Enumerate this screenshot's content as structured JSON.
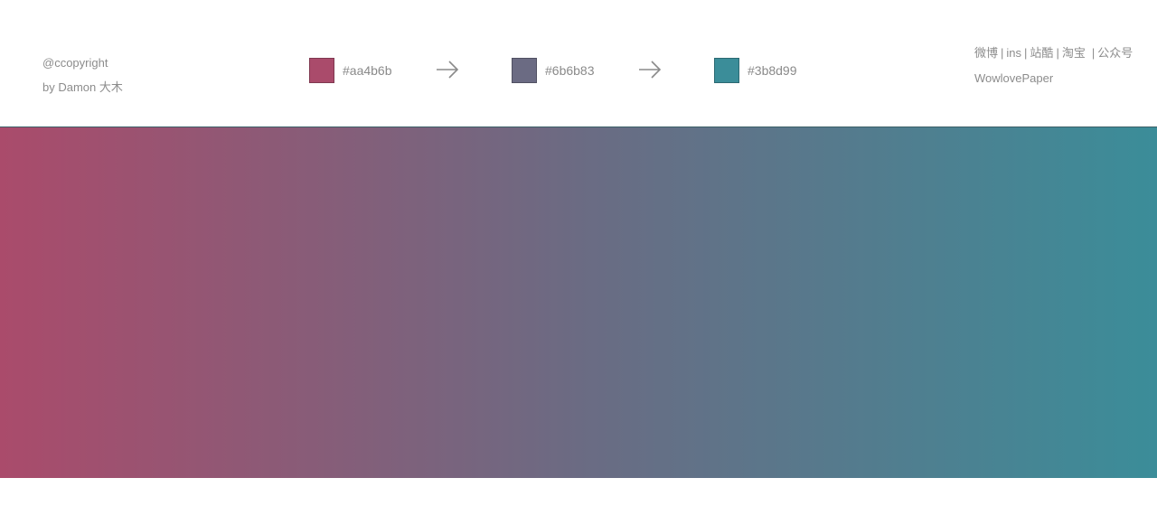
{
  "credit": {
    "line1": "@ccopyright",
    "line2": "by Damon 大木"
  },
  "palette": {
    "colors": [
      {
        "hex_label": "#aa4b6b",
        "color": "#aa4b6b"
      },
      {
        "hex_label": "#6b6b83",
        "color": "#6b6b83"
      },
      {
        "hex_label": "#3b8d99",
        "color": "#3b8d99"
      }
    ],
    "arrow_icon": "arrow-right-icon"
  },
  "links": {
    "items": [
      "微博",
      "ins",
      "站酷",
      "淘宝",
      "公众号"
    ],
    "separator": "|",
    "brand": "WowlovePaper"
  },
  "gradient": {
    "from": "#aa4b6b",
    "via": "#6b6b83",
    "to": "#3b8d99"
  }
}
